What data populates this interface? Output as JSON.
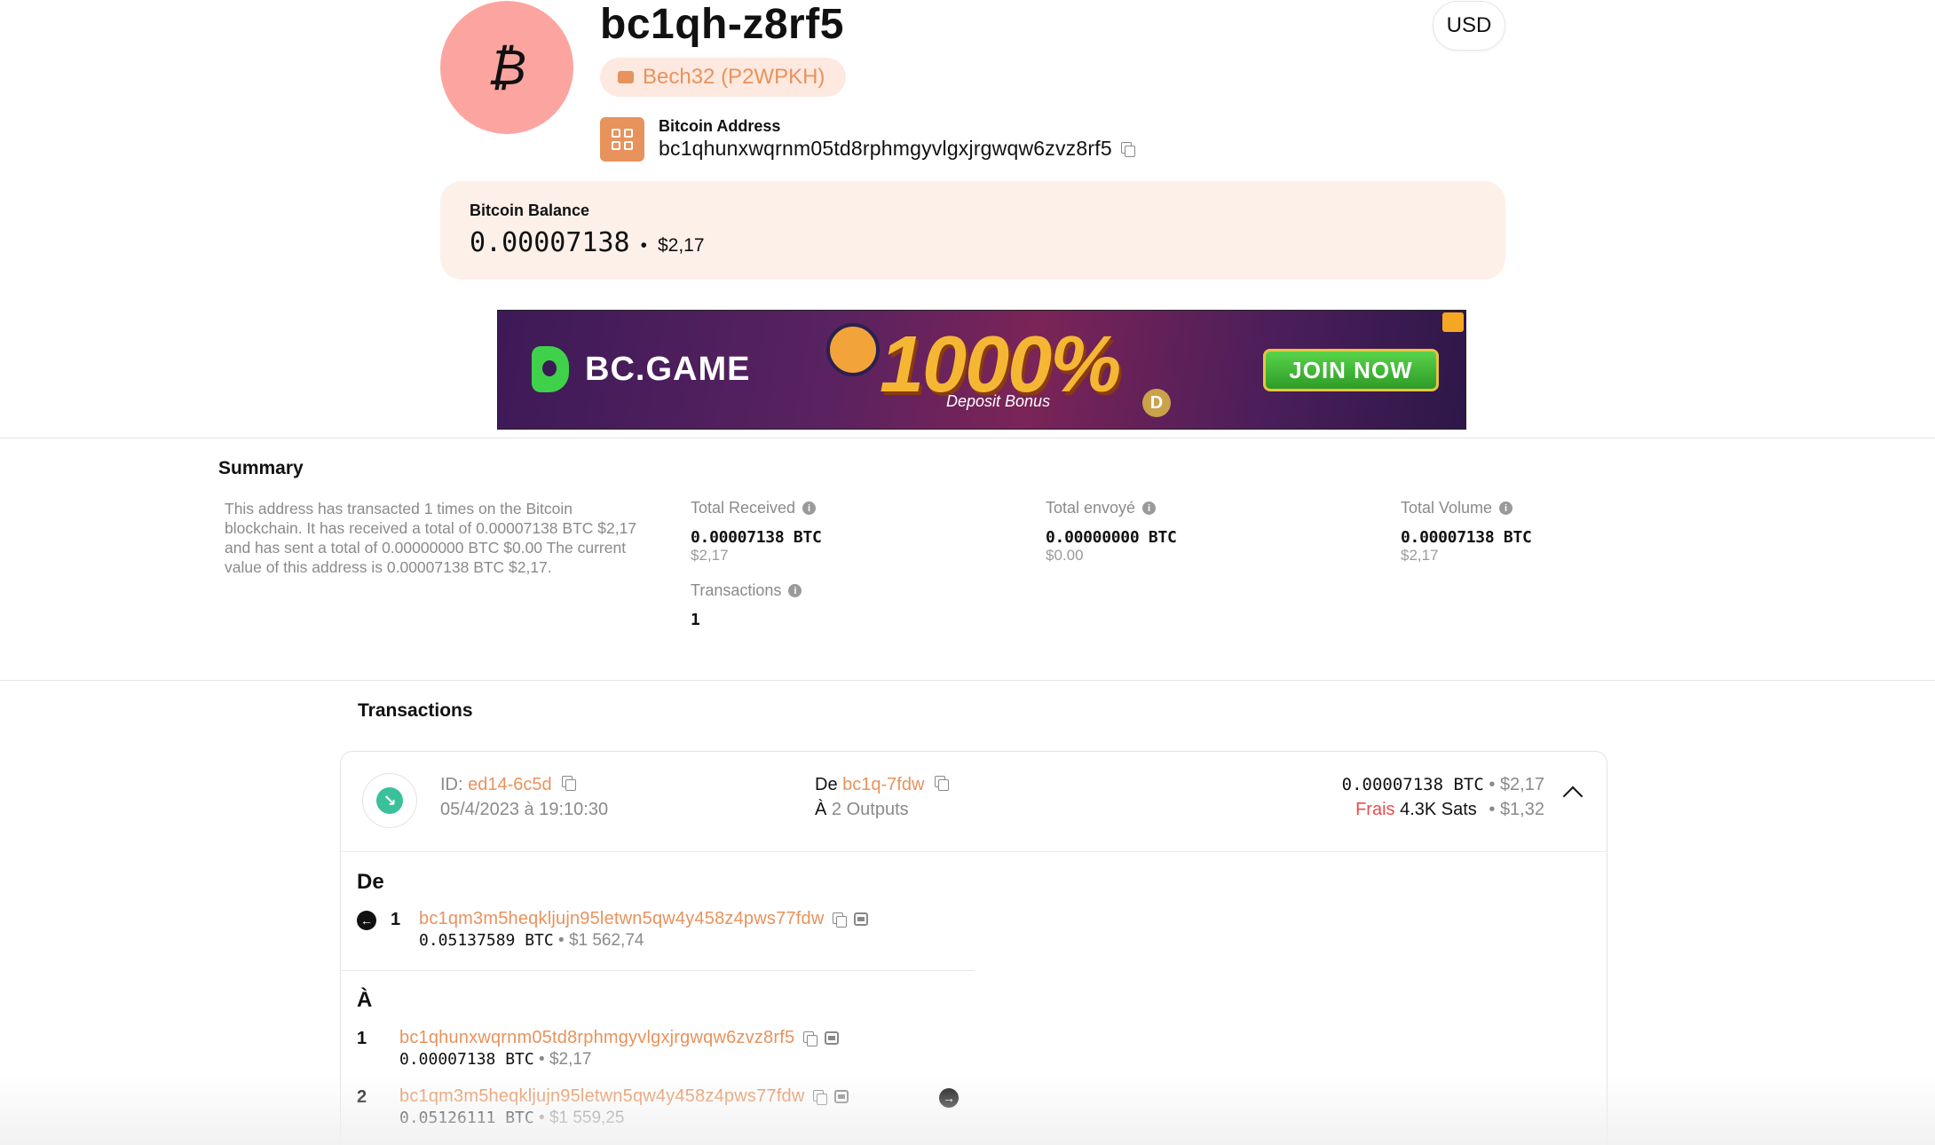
{
  "header": {
    "avatar_symbol": "₿",
    "address_short": "bc1qh-z8rf5",
    "address_type": "Bech32 (P2WPKH)",
    "currency": "USD",
    "address_label": "Bitcoin Address",
    "address_full": "bc1qhunxwqrnm05td8rphmgyvlgxjrgwqw6zvz8rf5"
  },
  "balance": {
    "label": "Bitcoin Balance",
    "btc": "0.00007138",
    "separator": "•",
    "usd": "$2,17"
  },
  "banner": {
    "brand": "BC.GAME",
    "promo": "1000%",
    "sub": "Deposit Bonus",
    "cta": "JOIN NOW",
    "coin": "D"
  },
  "summary": {
    "title": "Summary",
    "description": "This address has transacted 1 times on the Bitcoin blockchain. It has received a total of 0.00007138 BTC $2,17 and has sent a total of 0.00000000 BTC $0.00 The current value of this address is 0.00007138 BTC $2,17.",
    "total_received": {
      "label": "Total Received",
      "btc": "0.00007138 BTC",
      "usd": "$2,17"
    },
    "total_sent": {
      "label": "Total envoyé",
      "btc": "0.00000000 BTC",
      "usd": "$0.00"
    },
    "total_volume": {
      "label": "Total Volume",
      "btc": "0.00007138 BTC",
      "usd": "$2,17"
    },
    "transactions": {
      "label": "Transactions",
      "value": "1"
    },
    "info_symbol": "i"
  },
  "transactions": {
    "title": "Transactions",
    "items": [
      {
        "id_label": "ID:",
        "id": "ed14-6c5d",
        "datetime": "05/4/2023 à 19:10:30",
        "from_label": "De",
        "from": "bc1q-7fdw",
        "to_label": "À",
        "to": "2 Outputs",
        "amount_btc": "0.00007138 BTC",
        "amount_usd": "$2,17",
        "fee_label": "Frais",
        "fee_sats": "4.3K Sats",
        "fee_usd": "$1,32",
        "bullet": "•",
        "inputs_title": "De",
        "inputs": [
          {
            "num": "1",
            "address": "bc1qm3m5heqkljujn95letwn5qw4y458z4pws77fdw",
            "btc": "0.05137589 BTC",
            "usd": "$1 562,74"
          }
        ],
        "outputs_title": "À",
        "outputs": [
          {
            "num": "1",
            "address": "bc1qhunxwqrnm05td8rphmgyvlgxjrgwqw6zvz8rf5",
            "btc": "0.00007138 BTC",
            "usd": "$2,17"
          },
          {
            "num": "2",
            "address": "bc1qm3m5heqkljujn95letwn5qw4y458z4pws77fdw",
            "btc": "0.05126111 BTC",
            "usd": "$1 559,25"
          }
        ]
      }
    ]
  },
  "colors": {
    "accent": "#e8925c",
    "avatar_bg": "#fca5a0",
    "balance_bg": "#fdf0e9",
    "incoming": "#3ac09b",
    "fee": "#e84d4d"
  },
  "icons": {
    "copy": "copy-icon",
    "qr": "qr-code-icon",
    "wallet": "wallet-icon",
    "info": "info-icon",
    "script": "script-icon",
    "incoming": "incoming-arrow-icon",
    "collapse": "chevron-up-icon"
  }
}
